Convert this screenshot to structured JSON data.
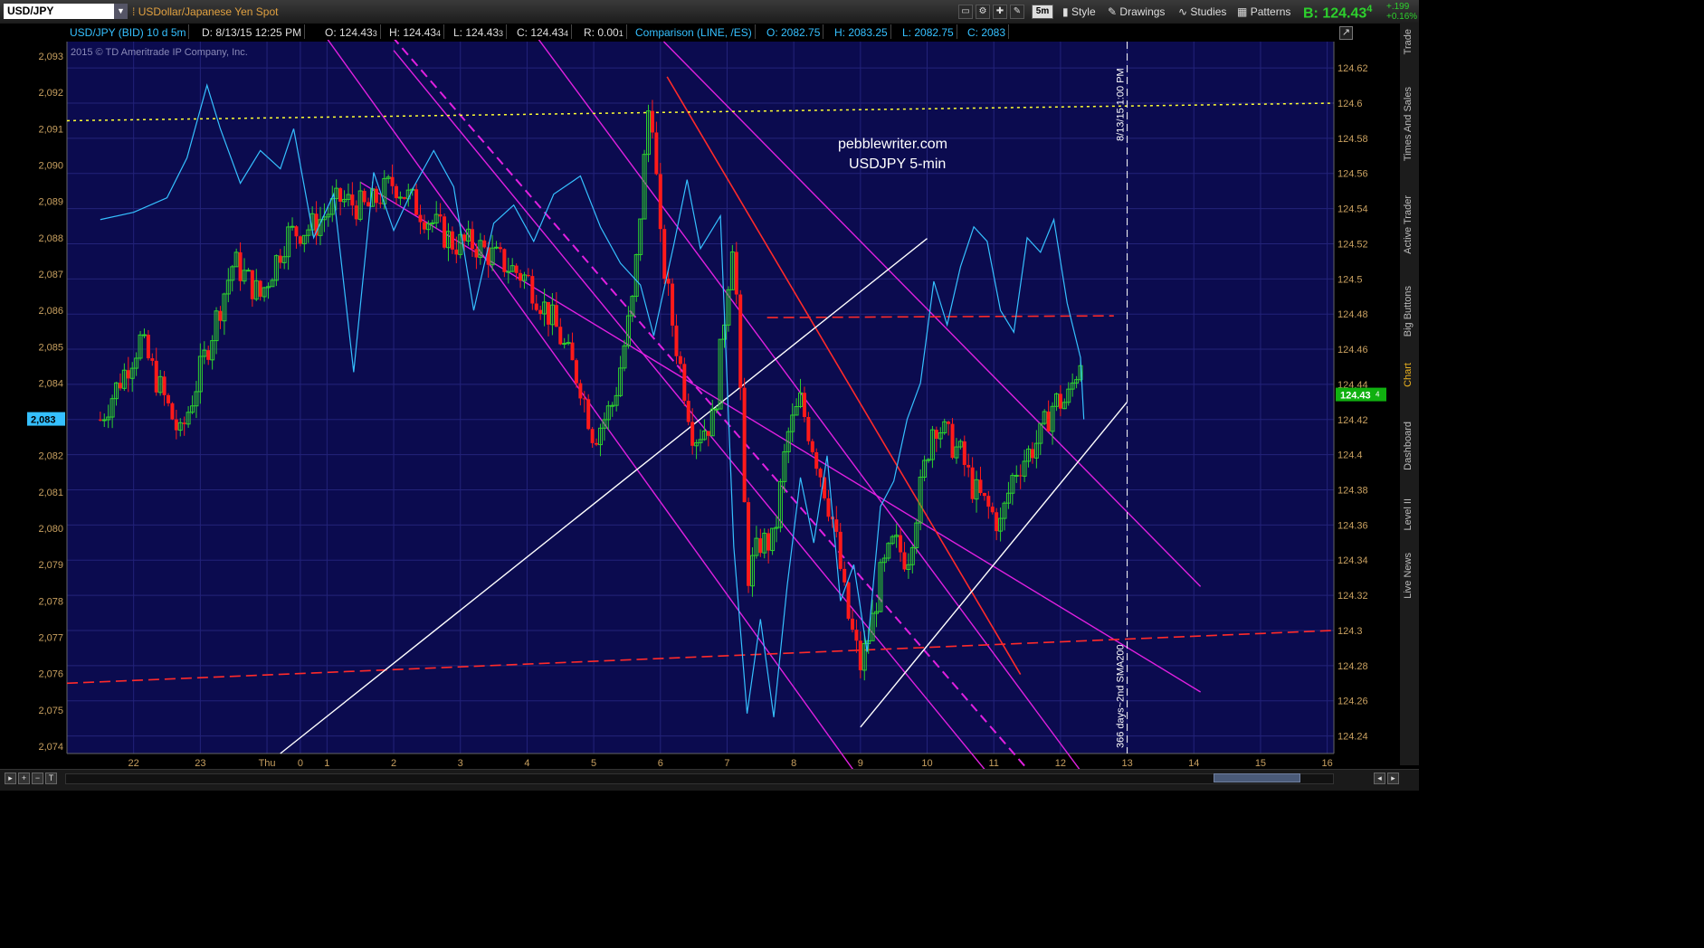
{
  "toolbar": {
    "symbol": "USD/JPY",
    "symbol_description": "USDollar/Japanese Yen Spot",
    "interval_badge": "5m",
    "style_label": "Style",
    "drawings_label": "Drawings",
    "studies_label": "Studies",
    "patterns_label": "Patterns",
    "bid_label": "B: 124.43",
    "bid_fraction": "4",
    "change_abs": "+.199",
    "change_pct": "+0.16%"
  },
  "infobar": {
    "symbol": "USD/JPY (BID) 10 d 5m",
    "date": "D: 8/13/15 12:25 PM",
    "open": "O: 124.43",
    "open_frac": "3",
    "high": "H: 124.43",
    "high_frac": "4",
    "low": "L: 124.43",
    "low_frac": "3",
    "close": "C: 124.43",
    "close_frac": "4",
    "range": "R: 0.00",
    "range_frac": "1",
    "comparison": "Comparison (LINE, /ES)",
    "cmp_open": "O: 2082.75",
    "cmp_high": "H: 2083.25",
    "cmp_low": "L: 2082.75",
    "cmp_close": "C: 2083"
  },
  "right_tabs": [
    "Trade",
    "Times And Sales",
    "Active Trader",
    "Big Buttons",
    "Chart",
    "Dashboard",
    "Level II",
    "Live News"
  ],
  "colors": {
    "plot_bg": "#0b0b4f",
    "grid": "#23237a",
    "comparison_line": "#35c0ff",
    "up_candle": "#2dd02d",
    "down_candle": "#ff1a1a",
    "channel": "#e020e0",
    "trendline": "#ffffff",
    "red_lines": "#ff2a2a",
    "yellow_line": "#ffff33",
    "axis_text": "#c8a060"
  },
  "chart_data": {
    "type": "line",
    "copyright": "2015 © TD Ameritrade IP Company, Inc.",
    "annotations": [
      "pebblewriter.com",
      "USDJPY 5-min",
      "8/13/15 1:00 PM",
      "366 days~2nd SMA200"
    ],
    "price_axis": {
      "side": "right",
      "range": [
        124.23,
        124.635
      ],
      "ticks": [
        "124.62",
        "124.6",
        "124.58",
        "124.56",
        "124.54",
        "124.52",
        "124.5",
        "124.48",
        "124.46",
        "124.44",
        "124.42",
        "124.4",
        "124.38",
        "124.36",
        "124.34",
        "124.32",
        "124.3",
        "124.28",
        "124.26",
        "124.24"
      ],
      "last_price_label": "124.43",
      "last_price_frac": "4",
      "last_price": 124.434
    },
    "comparison_axis": {
      "side": "left",
      "range": [
        2073.8,
        2093.4
      ],
      "ticks": [
        "2,093",
        "2,092",
        "2,091",
        "2,090",
        "2,089",
        "2,088",
        "2,087",
        "2,086",
        "2,085",
        "2,084",
        "2,083",
        "2,082",
        "2,081",
        "2,080",
        "2,079",
        "2,078",
        "2,077",
        "2,076",
        "2,075",
        "2,074"
      ],
      "last_price_label": "2,083",
      "last_price": 2083
    },
    "time_axis": {
      "labels": [
        {
          "label": "22",
          "t": 0.5
        },
        {
          "label": "23",
          "t": 1.5
        },
        {
          "label": "Thu",
          "t": 2.5
        },
        {
          "label": "0",
          "t": 3.0
        },
        {
          "label": "1",
          "t": 3.4
        },
        {
          "label": "2",
          "t": 4.4
        },
        {
          "label": "3",
          "t": 5.4
        },
        {
          "label": "4",
          "t": 6.4
        },
        {
          "label": "5",
          "t": 7.4
        },
        {
          "label": "6",
          "t": 8.4
        },
        {
          "label": "7",
          "t": 9.4
        },
        {
          "label": "8",
          "t": 10.4
        },
        {
          "label": "9",
          "t": 11.4
        },
        {
          "label": "10",
          "t": 12.4
        },
        {
          "label": "11",
          "t": 13.4
        },
        {
          "label": "12",
          "t": 14.4
        },
        {
          "label": "13",
          "t": 15.4
        },
        {
          "label": "14",
          "t": 16.4
        },
        {
          "label": "15",
          "t": 17.4
        },
        {
          "label": "16",
          "t": 18.4
        }
      ],
      "range": [
        -0.5,
        18.5
      ],
      "last_bar_t": 14.75,
      "marker_t": 15.4
    },
    "candles_anchor": [
      [
        0,
        124.42
      ],
      [
        0.6,
        124.465
      ],
      [
        1.2,
        124.41
      ],
      [
        1.6,
        124.46
      ],
      [
        2.0,
        124.51
      ],
      [
        2.4,
        124.49
      ],
      [
        2.8,
        124.525
      ],
      [
        3.2,
        124.53
      ],
      [
        3.6,
        124.545
      ],
      [
        4.0,
        124.54
      ],
      [
        4.4,
        124.555
      ],
      [
        4.9,
        124.535
      ],
      [
        5.3,
        124.52
      ],
      [
        5.6,
        124.52
      ],
      [
        6.0,
        124.51
      ],
      [
        6.4,
        124.5
      ],
      [
        6.8,
        124.475
      ],
      [
        7.2,
        124.44
      ],
      [
        7.4,
        124.41
      ],
      [
        7.7,
        124.43
      ],
      [
        8.0,
        124.49
      ],
      [
        8.25,
        124.61
      ],
      [
        8.4,
        124.52
      ],
      [
        8.6,
        124.47
      ],
      [
        8.9,
        124.41
      ],
      [
        9.2,
        124.42
      ],
      [
        9.5,
        124.53
      ],
      [
        9.7,
        124.33
      ],
      [
        9.9,
        124.35
      ],
      [
        10.1,
        124.35
      ],
      [
        10.3,
        124.41
      ],
      [
        10.5,
        124.43
      ],
      [
        10.8,
        124.39
      ],
      [
        11.0,
        124.36
      ],
      [
        11.2,
        124.31
      ],
      [
        11.4,
        124.28
      ],
      [
        11.55,
        124.3
      ],
      [
        11.7,
        124.33
      ],
      [
        11.9,
        124.35
      ],
      [
        12.1,
        124.34
      ],
      [
        12.3,
        124.38
      ],
      [
        12.5,
        124.42
      ],
      [
        12.7,
        124.41
      ],
      [
        12.9,
        124.4
      ],
      [
        13.1,
        124.38
      ],
      [
        13.3,
        124.37
      ],
      [
        13.5,
        124.36
      ],
      [
        13.7,
        124.39
      ],
      [
        13.9,
        124.4
      ],
      [
        14.1,
        124.41
      ],
      [
        14.3,
        124.43
      ],
      [
        14.5,
        124.43
      ],
      [
        14.7,
        124.455
      ],
      [
        14.75,
        124.434
      ]
    ],
    "comparison_series": [
      [
        0,
        2088.5
      ],
      [
        0.5,
        2088.7
      ],
      [
        1.0,
        2089.1
      ],
      [
        1.3,
        2090.2
      ],
      [
        1.6,
        2092.2
      ],
      [
        1.8,
        2091.0
      ],
      [
        2.1,
        2089.5
      ],
      [
        2.4,
        2090.4
      ],
      [
        2.7,
        2089.9
      ],
      [
        2.9,
        2091.0
      ],
      [
        3.2,
        2088.0
      ],
      [
        3.5,
        2089.2
      ],
      [
        3.8,
        2084.3
      ],
      [
        4.1,
        2089.8
      ],
      [
        4.4,
        2088.2
      ],
      [
        4.7,
        2089.4
      ],
      [
        5.0,
        2090.4
      ],
      [
        5.3,
        2089.4
      ],
      [
        5.6,
        2086.0
      ],
      [
        5.9,
        2088.4
      ],
      [
        6.2,
        2088.9
      ],
      [
        6.5,
        2087.9
      ],
      [
        6.8,
        2089.2
      ],
      [
        7.2,
        2089.7
      ],
      [
        7.5,
        2088.3
      ],
      [
        7.8,
        2087.3
      ],
      [
        8.1,
        2086.7
      ],
      [
        8.3,
        2085.3
      ],
      [
        8.6,
        2087.8
      ],
      [
        8.8,
        2089.6
      ],
      [
        9.0,
        2087.7
      ],
      [
        9.3,
        2088.6
      ],
      [
        9.5,
        2079.5
      ],
      [
        9.7,
        2074.9
      ],
      [
        9.9,
        2077.5
      ],
      [
        10.1,
        2074.8
      ],
      [
        10.3,
        2078.4
      ],
      [
        10.5,
        2081.4
      ],
      [
        10.7,
        2079.6
      ],
      [
        10.9,
        2082.0
      ],
      [
        11.1,
        2078.0
      ],
      [
        11.3,
        2079.0
      ],
      [
        11.5,
        2076.6
      ],
      [
        11.7,
        2080.6
      ],
      [
        11.9,
        2081.3
      ],
      [
        12.1,
        2083.0
      ],
      [
        12.3,
        2084.0
      ],
      [
        12.5,
        2086.8
      ],
      [
        12.7,
        2085.6
      ],
      [
        12.9,
        2087.2
      ],
      [
        13.1,
        2088.3
      ],
      [
        13.3,
        2087.9
      ],
      [
        13.5,
        2086.0
      ],
      [
        13.7,
        2085.4
      ],
      [
        13.9,
        2088.0
      ],
      [
        14.1,
        2087.6
      ],
      [
        14.3,
        2088.5
      ],
      [
        14.5,
        2086.2
      ],
      [
        14.7,
        2084.7
      ],
      [
        14.75,
        2083.0
      ]
    ],
    "drawings": {
      "channel_lines": [
        [
          [
            2.2,
            124.7
          ],
          [
            11.4,
            124.215
          ]
        ],
        [
          [
            4.4,
            124.63
          ],
          [
            13.5,
            124.21
          ]
        ],
        [
          [
            6.5,
            124.64
          ],
          [
            14.9,
            124.21
          ]
        ],
        [
          [
            8.45,
            124.635
          ],
          [
            16.5,
            124.325
          ]
        ],
        [
          [
            3.9,
            124.555
          ],
          [
            16.5,
            124.265
          ]
        ]
      ],
      "channel_dashed": [
        [
          4.1,
          124.65
        ],
        [
          14.5,
          124.195
        ]
      ],
      "red_downtrend": [
        [
          8.5,
          124.615
        ],
        [
          13.8,
          124.275
        ]
      ],
      "red_dashed_lower": [
        [
          -0.5,
          124.27
        ],
        [
          18.5,
          124.3
        ]
      ],
      "red_dashed_upper": [
        [
          10.0,
          124.478
        ],
        [
          15.2,
          124.479
        ]
      ],
      "white_trend_1": [
        [
          2.7,
          124.23
        ],
        [
          12.4,
          124.523
        ]
      ],
      "white_trend_2": [
        [
          11.4,
          124.245
        ],
        [
          15.4,
          124.43
        ]
      ],
      "yellow_dotted": [
        [
          -0.5,
          124.59
        ],
        [
          18.5,
          124.6
        ]
      ]
    }
  }
}
